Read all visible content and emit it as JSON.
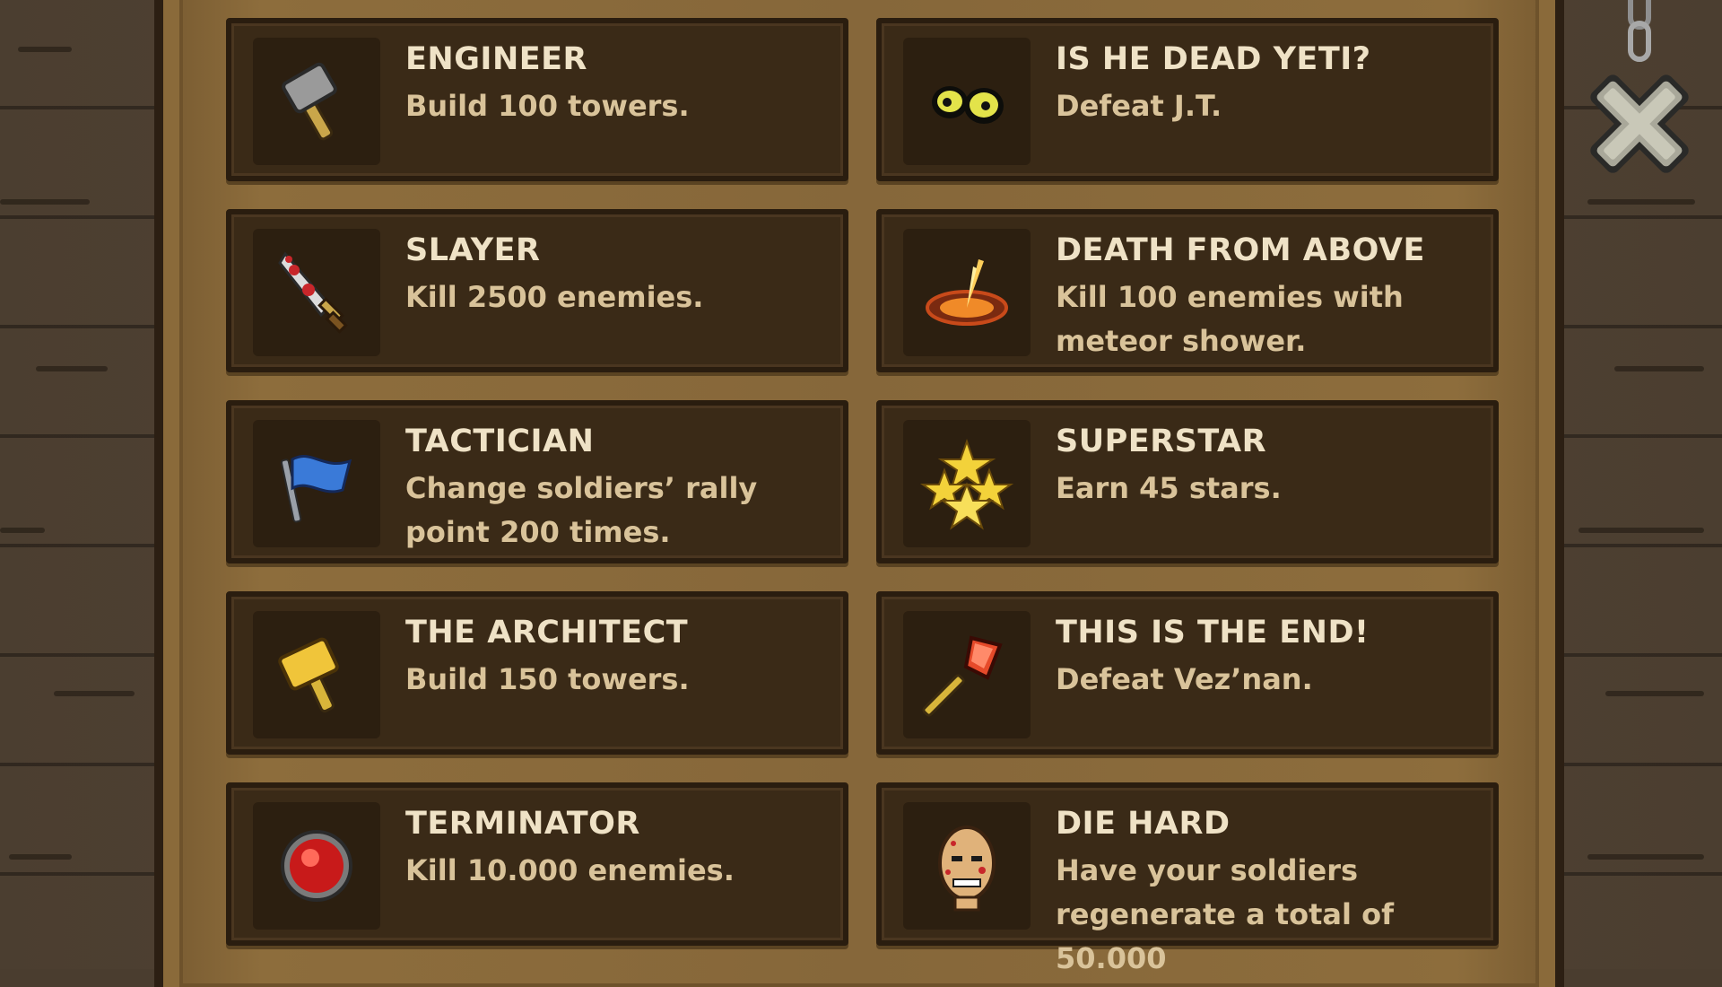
{
  "achievements": [
    {
      "title": "ENGINEER",
      "desc": "Build 100 towers.",
      "icon": "hammer-icon"
    },
    {
      "title": "IS HE DEAD YETI?",
      "desc": "Defeat J.T.",
      "icon": "glowing-eyes-icon"
    },
    {
      "title": "SLAYER",
      "desc": "Kill 2500 enemies.",
      "icon": "bloody-sword-icon"
    },
    {
      "title": "DEATH FROM ABOVE",
      "desc": "Kill 100 enemies with meteor shower.",
      "icon": "meteor-crater-icon"
    },
    {
      "title": "TACTICIAN",
      "desc": "Change soldiers’ rally point 200 times.",
      "icon": "rally-flag-icon"
    },
    {
      "title": "SUPERSTAR",
      "desc": "Earn 45 stars.",
      "icon": "stars-icon"
    },
    {
      "title": "THE ARCHITECT",
      "desc": "Build 150 towers.",
      "icon": "golden-hammer-icon"
    },
    {
      "title": "THIS IS THE END!",
      "desc": "Defeat Vez’nan.",
      "icon": "staff-gem-icon"
    },
    {
      "title": "TERMINATOR",
      "desc": "Kill 10.000 enemies.",
      "icon": "red-orb-icon"
    },
    {
      "title": "DIE HARD",
      "desc": "Have your soldiers regenerate a total of 50.000",
      "icon": "bald-soldier-head-icon"
    }
  ],
  "close_icon": "close-x-icon",
  "colors": {
    "title": "#efe2c6",
    "desc": "#d9c39a",
    "card": "#3a2a17",
    "frame": "#8a6a3a"
  }
}
